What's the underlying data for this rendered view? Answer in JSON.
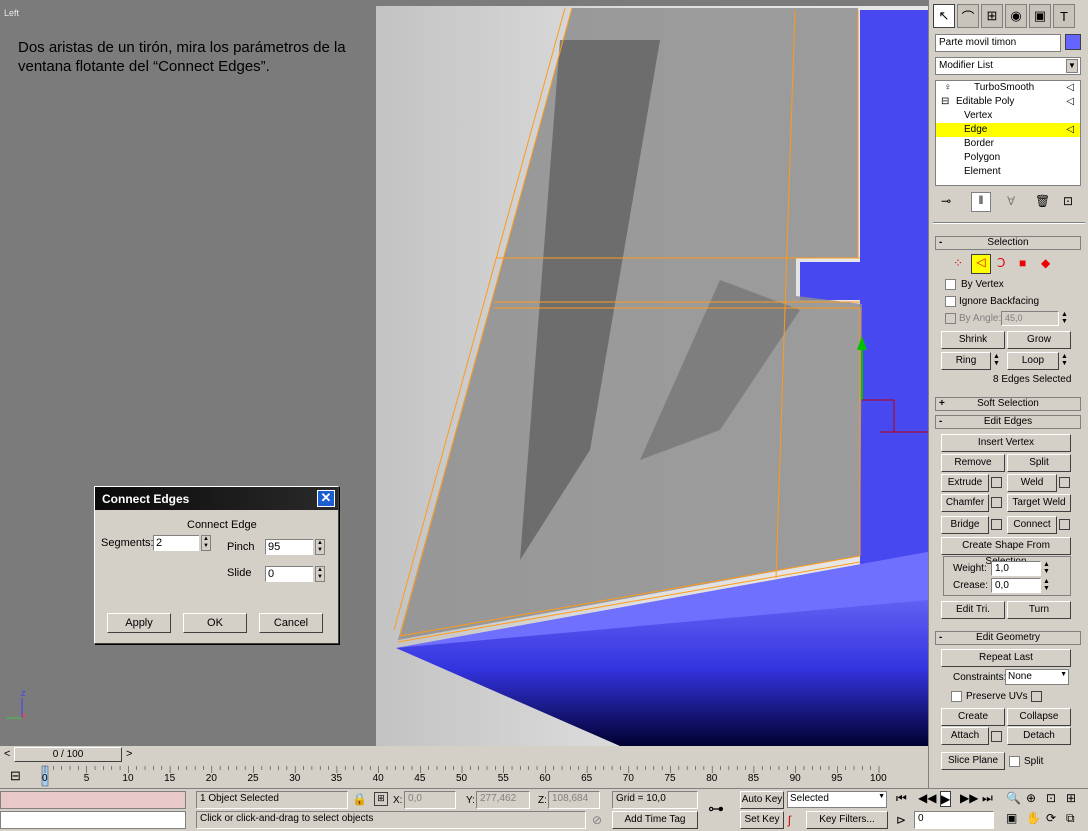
{
  "viewport": {
    "label": "Left",
    "note": "Dos aristas de un tirón, mira los parámetros de la ventana flotante del “Connect Edges”.",
    "axis": {
      "x": "x",
      "z": "z"
    }
  },
  "dialog": {
    "title": "Connect Edges",
    "group_label": "Connect Edge",
    "segments_label": "Segments:",
    "segments": "2",
    "pinch_label": "Pinch",
    "pinch": "95",
    "slide_label": "Slide",
    "slide": "0",
    "apply": "Apply",
    "ok": "OK",
    "cancel": "Cancel"
  },
  "panel": {
    "object_name": "Parte movil timon",
    "object_color": "#6464ff",
    "modifier_list": "Modifier List",
    "stack": [
      "TurboSmooth",
      "Editable Poly",
      "Vertex",
      "Edge",
      "Border",
      "Polygon",
      "Element"
    ],
    "stack_selected": "Edge",
    "selection": {
      "title": "Selection",
      "by_vertex": "By Vertex",
      "ignore_backfacing": "Ignore Backfacing",
      "by_angle": "By Angle:",
      "angle": "45,0",
      "shrink": "Shrink",
      "grow": "Grow",
      "ring": "Ring",
      "loop": "Loop",
      "status": "8 Edges Selected"
    },
    "soft_selection": "Soft Selection",
    "edit_edges": {
      "title": "Edit Edges",
      "insert_vertex": "Insert Vertex",
      "remove": "Remove",
      "split": "Split",
      "extrude": "Extrude",
      "weld": "Weld",
      "chamfer": "Chamfer",
      "target_weld": "Target Weld",
      "bridge": "Bridge",
      "connect": "Connect",
      "create_shape": "Create Shape From Selection",
      "weight_label": "Weight:",
      "weight": "1,0",
      "crease_label": "Crease:",
      "crease": "0,0",
      "edit_tri": "Edit Tri.",
      "turn": "Turn"
    },
    "edit_geometry": {
      "title": "Edit Geometry",
      "repeat_last": "Repeat Last",
      "constraints_label": "Constraints:",
      "constraints": "None",
      "preserve_uvs": "Preserve UVs",
      "create": "Create",
      "collapse": "Collapse",
      "attach": "Attach",
      "detach": "Detach",
      "slice_plane": "Slice Plane",
      "split": "Split"
    }
  },
  "timeline": {
    "frame": "0 / 100",
    "ticks": [
      "0",
      "5",
      "10",
      "15",
      "20",
      "25",
      "30",
      "35",
      "40",
      "45",
      "50",
      "55",
      "60",
      "65",
      "70",
      "75",
      "80",
      "85",
      "90",
      "95",
      "100"
    ]
  },
  "status": {
    "selected": "1 Object Selected",
    "prompt": "Click or click-and-drag to select objects",
    "x_label": "X:",
    "x": "0,0",
    "y_label": "Y:",
    "y": "277,462",
    "z_label": "Z:",
    "z": "108,684",
    "grid": "Grid = 10,0",
    "add_time_tag": "Add Time Tag",
    "auto_key": "Auto Key",
    "set_key": "Set Key",
    "key_mode": "Selected",
    "key_filters": "Key Filters...",
    "current_frame": "0"
  }
}
